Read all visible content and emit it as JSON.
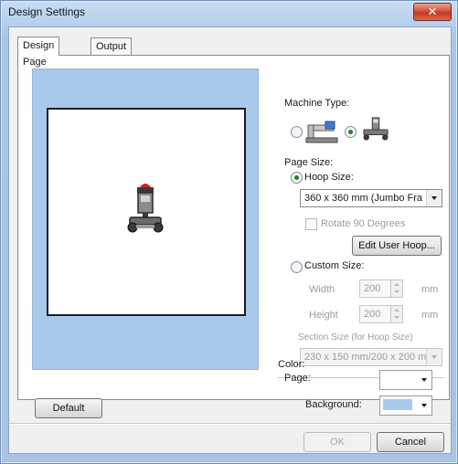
{
  "window": {
    "title": "Design Settings",
    "close_label": "✕"
  },
  "tabs": [
    {
      "label": "Design Page",
      "active": true
    },
    {
      "label": "Output",
      "active": false
    }
  ],
  "machine_type": {
    "label": "Machine Type:",
    "options": [
      {
        "icon": "sewing-machine-icon",
        "selected": false
      },
      {
        "icon": "embroidery-machine-icon",
        "selected": true
      }
    ]
  },
  "page_size": {
    "label": "Page Size:",
    "hoop_size": {
      "label": "Hoop Size:",
      "selected": true,
      "value": "360 x 360 mm (Jumbo Fra"
    },
    "rotate": {
      "label": "Rotate 90 Degrees",
      "checked": false,
      "enabled": false
    },
    "edit_user_hoop_label": "Edit User Hoop...",
    "custom_size": {
      "label": "Custom Size:",
      "selected": false,
      "width_label": "Width",
      "width_value": "200",
      "height_label": "Height",
      "height_value": "200",
      "unit": "mm",
      "section_label": "Section Size (for Hoop Size)",
      "section_value": "230 x 150 mm/200 x 200 m"
    }
  },
  "color": {
    "label": "Color:",
    "page_label": "Page:",
    "page_color": "#ffffff",
    "background_label": "Background:",
    "background_color": "#a9c9ec"
  },
  "buttons": {
    "default": "Default",
    "ok": "OK",
    "cancel": "Cancel"
  }
}
